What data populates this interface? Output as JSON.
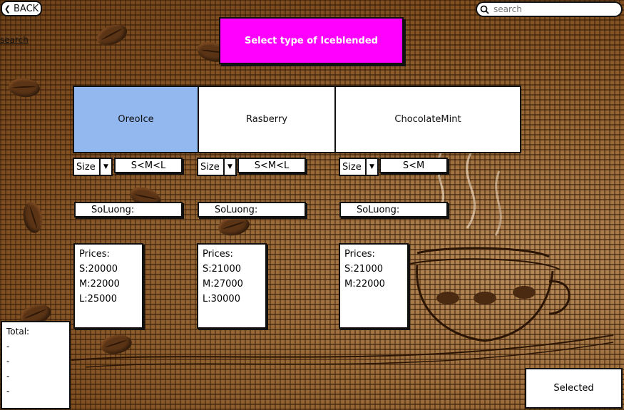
{
  "header": {
    "back_label": "BACK",
    "search_placeholder": "search",
    "search_link": "search",
    "title": "Select type of Iceblended"
  },
  "flavors": [
    {
      "name": "OreoIce",
      "selected": true,
      "size_label": "Size",
      "size_value": "S<M<L",
      "quantity_label": "SoLuong:",
      "prices_title": "Prices:",
      "prices": [
        "S:20000",
        "M:22000",
        "L:25000"
      ]
    },
    {
      "name": "Rasberry",
      "selected": false,
      "size_label": "Size",
      "size_value": "S<M<L",
      "quantity_label": "SoLuong:",
      "prices_title": "Prices:",
      "prices": [
        "S:21000",
        "M:27000",
        "L:30000"
      ]
    },
    {
      "name": "ChocolateMint",
      "selected": false,
      "size_label": "Size",
      "size_value": "S<M",
      "quantity_label": "SoLuong:",
      "prices_title": "Prices:",
      "prices": [
        "S:21000",
        "M:22000"
      ]
    }
  ],
  "total": {
    "label": "Total:",
    "lines": [
      "-",
      "-",
      "-",
      "-"
    ]
  },
  "selected_button": "Selected",
  "colors": {
    "title_banner": "#ff00ff",
    "selected_flavor": "#93b8f0",
    "background": "#8a5a2b"
  }
}
